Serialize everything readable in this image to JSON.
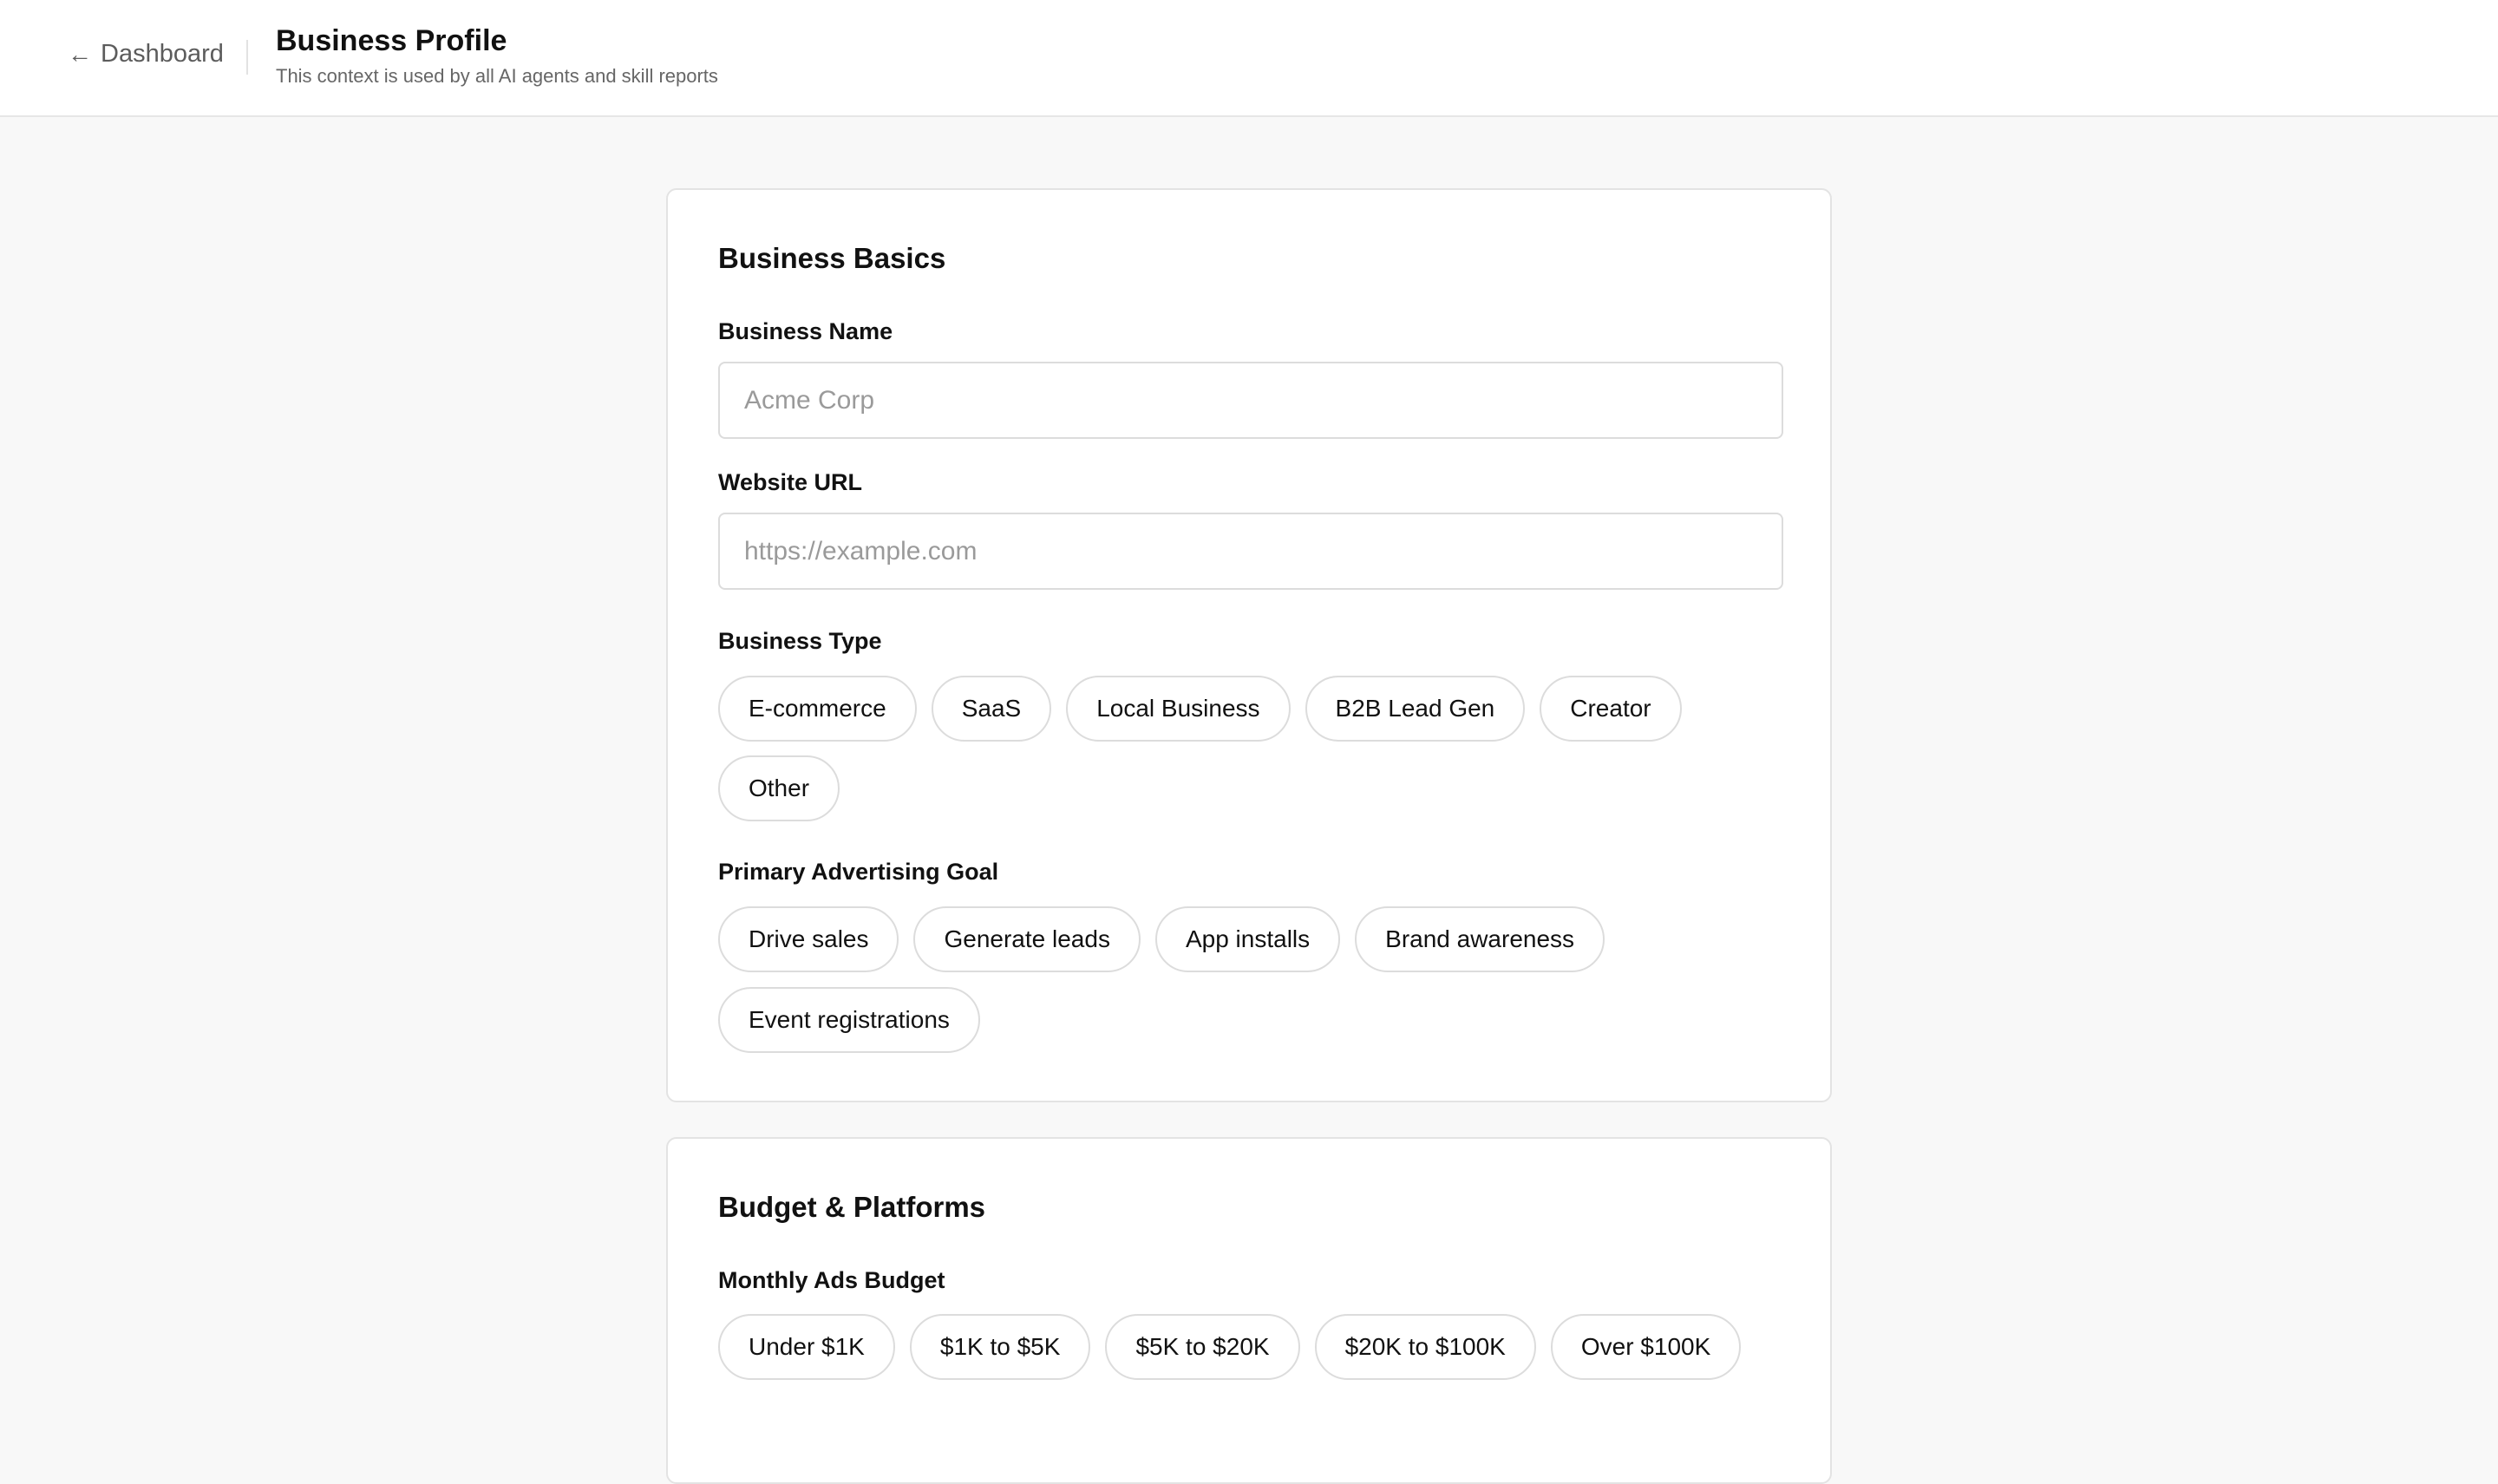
{
  "header": {
    "back_icon": "arrow-left-icon",
    "back_label": "Dashboard",
    "title": "Business Profile",
    "subtitle": "This context is used by all AI agents and skill reports"
  },
  "basics": {
    "title": "Business Basics",
    "business_name": {
      "label": "Business Name",
      "placeholder": "Acme Corp",
      "value": ""
    },
    "website_url": {
      "label": "Website URL",
      "placeholder": "https://example.com",
      "value": ""
    },
    "business_type": {
      "label": "Business Type",
      "options": [
        "E-commerce",
        "SaaS",
        "Local Business",
        "B2B Lead Gen",
        "Creator",
        "Other"
      ]
    },
    "advertising_goal": {
      "label": "Primary Advertising Goal",
      "options": [
        "Drive sales",
        "Generate leads",
        "App installs",
        "Brand awareness",
        "Event registrations"
      ]
    }
  },
  "budget": {
    "title": "Budget & Platforms",
    "monthly_budget": {
      "label": "Monthly Ads Budget",
      "options": [
        "Under $1K",
        "$1K to $5K",
        "$5K to $20K",
        "$20K to $100K",
        "Over $100K"
      ]
    }
  },
  "colors": {
    "page_background": "#f8f8f8",
    "card_background": "#ffffff",
    "border": "#dcdcdc",
    "text_primary": "#111111",
    "text_secondary": "#666666"
  }
}
